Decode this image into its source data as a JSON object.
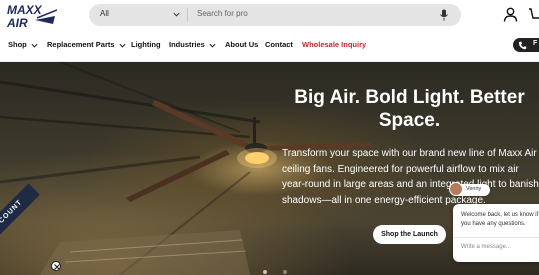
{
  "header": {
    "logo_text": "MAXX AIR",
    "search": {
      "category": "All",
      "placeholder": "Search for pro"
    }
  },
  "nav": {
    "items": [
      {
        "label": "Shop",
        "dropdown": true
      },
      {
        "label": "Replacement Parts",
        "dropdown": true
      },
      {
        "label": "Lighting",
        "dropdown": false
      },
      {
        "label": "Industries",
        "dropdown": true
      },
      {
        "label": "About Us",
        "dropdown": false
      },
      {
        "label": "Contact",
        "dropdown": false
      },
      {
        "label": "Wholesale Inquiry",
        "dropdown": false
      }
    ],
    "phone_label": "F"
  },
  "hero": {
    "title": "Big Air. Bold Light. Better Space.",
    "body": "Transform your space with our brand new line of Maxx Air ceiling fans. Engineered for powerful airflow to mix air year-round in large areas and an integrated light to banish shadows—all in one energy-efficient package.",
    "cta_label": "Shop the Launch"
  },
  "discount_ribbon": {
    "label": "DISCOUNT"
  },
  "chat": {
    "agent_name": "Venny",
    "message": "Welcome back, let us know if you have any questions.",
    "input_placeholder": "Write a message..."
  },
  "colors": {
    "wholesale": "#c8262a",
    "search_bg": "#e4e4e4",
    "ribbon_bg": "#1f2a44"
  }
}
